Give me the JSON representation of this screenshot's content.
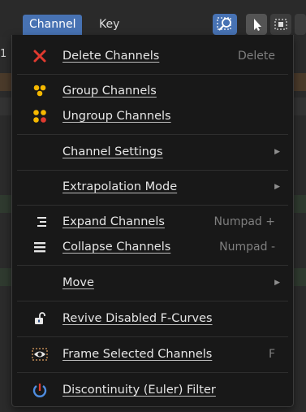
{
  "header": {
    "tabs": [
      {
        "label": "Channel"
      },
      {
        "label": "Key"
      }
    ]
  },
  "background": {
    "fragment": "1"
  },
  "menu": {
    "items": [
      {
        "label": "Delete Channels",
        "shortcut": "Delete",
        "icon": "x-icon",
        "submenu": false
      },
      {
        "label": "Group Channels",
        "shortcut": "",
        "icon": "group-icon",
        "submenu": false
      },
      {
        "label": "Ungroup Channels",
        "shortcut": "",
        "icon": "ungroup-icon",
        "submenu": false
      },
      {
        "label": "Channel Settings",
        "shortcut": "",
        "icon": "",
        "submenu": true
      },
      {
        "label": "Extrapolation Mode",
        "shortcut": "",
        "icon": "",
        "submenu": true
      },
      {
        "label": "Expand Channels",
        "shortcut": "Numpad +",
        "icon": "expand-icon",
        "submenu": false
      },
      {
        "label": "Collapse Channels",
        "shortcut": "Numpad -",
        "icon": "collapse-icon",
        "submenu": false
      },
      {
        "label": "Move",
        "shortcut": "",
        "icon": "",
        "submenu": true
      },
      {
        "label": "Revive Disabled F-Curves",
        "shortcut": "",
        "icon": "lock-open-icon",
        "submenu": false
      },
      {
        "label": "Frame Selected Channels",
        "shortcut": "F",
        "icon": "eye-frame-icon",
        "submenu": false
      },
      {
        "label": "Discontinuity (Euler) Filter",
        "shortcut": "",
        "icon": "discontinuity-icon",
        "submenu": false
      }
    ]
  },
  "colors": {
    "accent": "#4772b3",
    "menu_bg": "#181818",
    "text": "#e6e6e6",
    "shortcut_text": "#7f7f7f",
    "delete_red": "#e03a2f",
    "group_yellow": "#f5b800"
  }
}
